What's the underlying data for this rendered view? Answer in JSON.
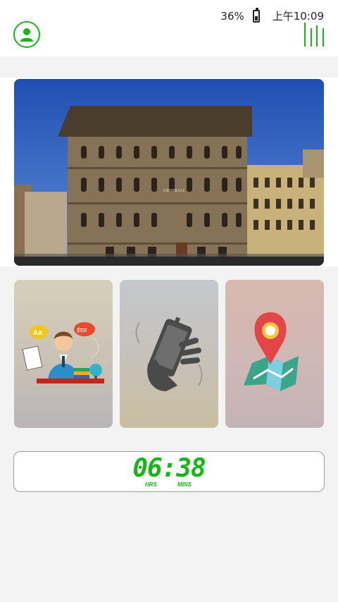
{
  "status_bar": {
    "battery": "36%",
    "time": "上午10:09",
    "battery_level": 0.36
  },
  "header": {
    "avatar_icon": "user-icon",
    "menu_icon": "bars-icon",
    "accent": "#16b816"
  },
  "banner": {
    "image": "palazzo-building-photo",
    "sign_text": "GENERALI"
  },
  "cards": [
    {
      "icon": "teacher-language-icon",
      "bubble_left": "Aa",
      "bubble_right": "ईदऊ"
    },
    {
      "icon": "phone-in-hand-icon"
    },
    {
      "icon": "map-pin-icon"
    }
  ],
  "clock": {
    "time": "06:38",
    "hours_label": "HRS",
    "minutes_label": "MINS"
  }
}
